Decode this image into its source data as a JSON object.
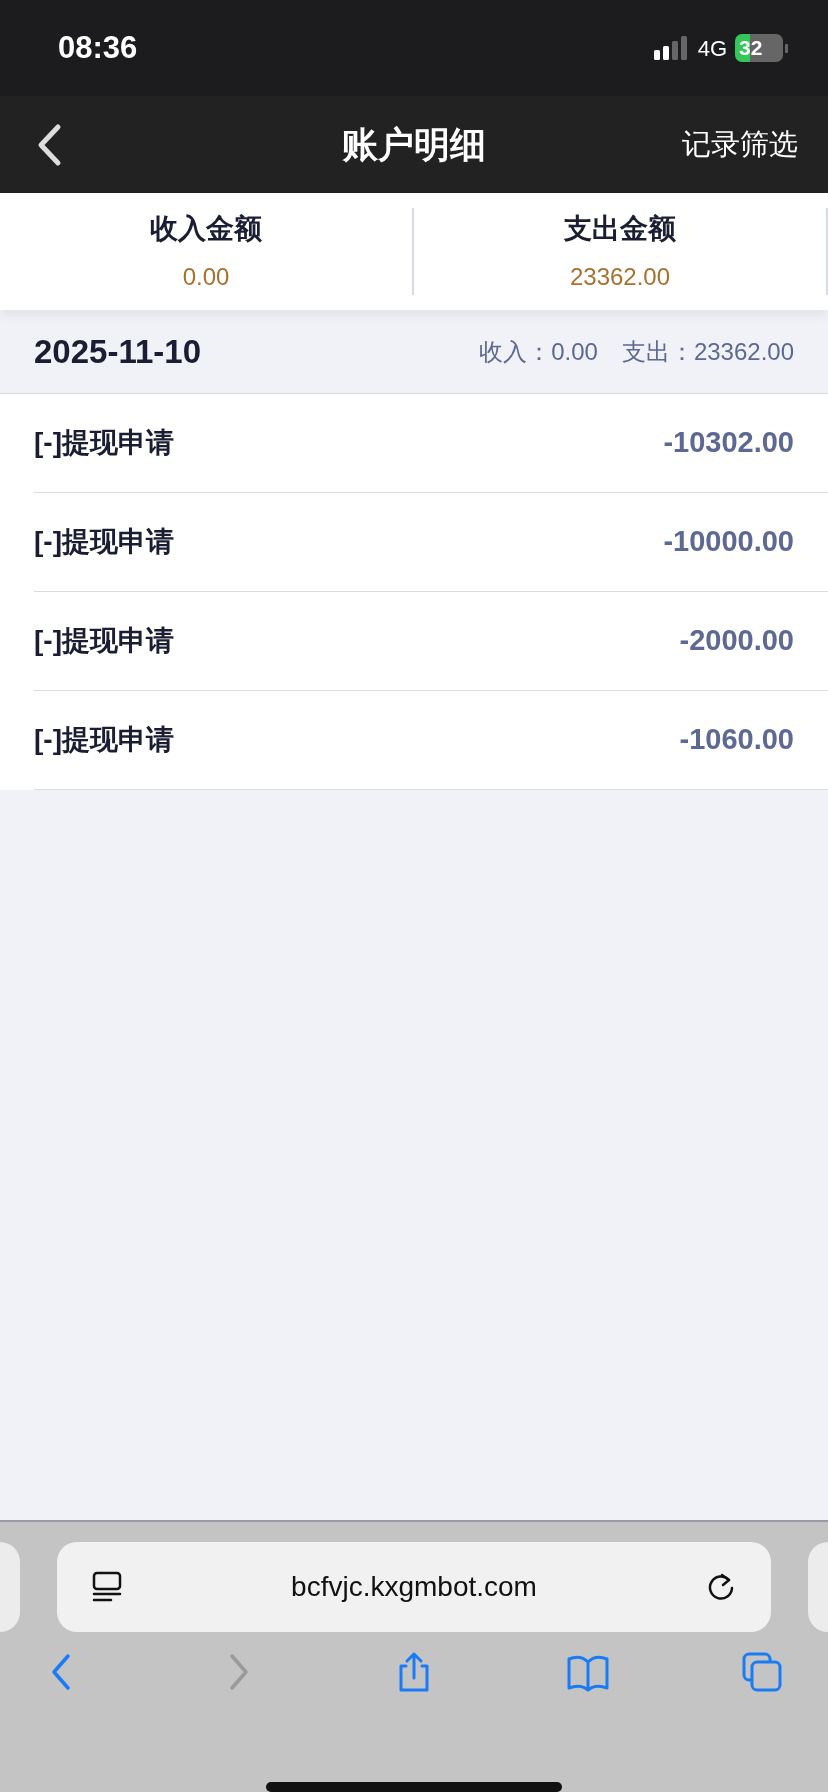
{
  "status_bar": {
    "time": "08:36",
    "network": "4G",
    "battery": "32"
  },
  "header": {
    "title": "账户明细",
    "action": "记录筛选"
  },
  "summary": [
    {
      "label": "收入金额",
      "amount": "0.00"
    },
    {
      "label": "支出金额",
      "amount": "23362.00"
    }
  ],
  "day": {
    "date": "2025-11-10",
    "income_label": "收入：",
    "income": "0.00",
    "expense_label": "支出：",
    "expense": "23362.00"
  },
  "records": [
    {
      "title": "[-]提现申请",
      "amount": "-10302.00"
    },
    {
      "title": "[-]提现申请",
      "amount": "-10000.00"
    },
    {
      "title": "[-]提现申请",
      "amount": "-2000.00"
    },
    {
      "title": "[-]提现申请",
      "amount": "-1060.00"
    }
  ],
  "browser": {
    "url": "bcfvjc.kxgmbot.com"
  },
  "toolbar": [
    {
      "kind": "back",
      "disabled": false
    },
    {
      "kind": "forward",
      "disabled": true
    },
    {
      "kind": "share",
      "disabled": false
    },
    {
      "kind": "bookmarks",
      "disabled": false
    },
    {
      "kind": "tabs",
      "disabled": false
    }
  ]
}
